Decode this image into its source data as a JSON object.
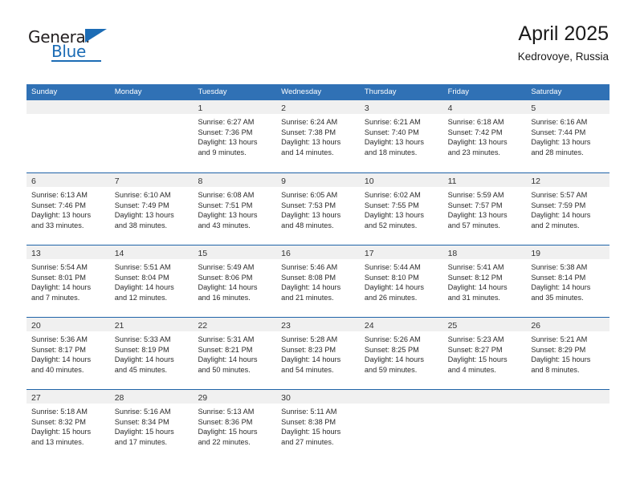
{
  "brand": {
    "name_part1": "General",
    "name_part2": "Blue",
    "triangle_icon": "triangle-icon",
    "accent_color": "#1c6cb5"
  },
  "header": {
    "title": "April 2025",
    "location": "Kedrovoye, Russia"
  },
  "theme": {
    "header_blue": "#3071b5",
    "row_rule": "#1f63a8",
    "daynum_band": "#f0f0f0"
  },
  "weekdays": [
    "Sunday",
    "Monday",
    "Tuesday",
    "Wednesday",
    "Thursday",
    "Friday",
    "Saturday"
  ],
  "weeks": [
    [
      {
        "day": "",
        "empty": true,
        "sunrise": "",
        "sunset": "",
        "daylight1": "",
        "daylight2": ""
      },
      {
        "day": "",
        "empty": true,
        "sunrise": "",
        "sunset": "",
        "daylight1": "",
        "daylight2": ""
      },
      {
        "day": "1",
        "sunrise": "Sunrise: 6:27 AM",
        "sunset": "Sunset: 7:36 PM",
        "daylight1": "Daylight: 13 hours",
        "daylight2": "and 9 minutes."
      },
      {
        "day": "2",
        "sunrise": "Sunrise: 6:24 AM",
        "sunset": "Sunset: 7:38 PM",
        "daylight1": "Daylight: 13 hours",
        "daylight2": "and 14 minutes."
      },
      {
        "day": "3",
        "sunrise": "Sunrise: 6:21 AM",
        "sunset": "Sunset: 7:40 PM",
        "daylight1": "Daylight: 13 hours",
        "daylight2": "and 18 minutes."
      },
      {
        "day": "4",
        "sunrise": "Sunrise: 6:18 AM",
        "sunset": "Sunset: 7:42 PM",
        "daylight1": "Daylight: 13 hours",
        "daylight2": "and 23 minutes."
      },
      {
        "day": "5",
        "sunrise": "Sunrise: 6:16 AM",
        "sunset": "Sunset: 7:44 PM",
        "daylight1": "Daylight: 13 hours",
        "daylight2": "and 28 minutes."
      }
    ],
    [
      {
        "day": "6",
        "sunrise": "Sunrise: 6:13 AM",
        "sunset": "Sunset: 7:46 PM",
        "daylight1": "Daylight: 13 hours",
        "daylight2": "and 33 minutes."
      },
      {
        "day": "7",
        "sunrise": "Sunrise: 6:10 AM",
        "sunset": "Sunset: 7:49 PM",
        "daylight1": "Daylight: 13 hours",
        "daylight2": "and 38 minutes."
      },
      {
        "day": "8",
        "sunrise": "Sunrise: 6:08 AM",
        "sunset": "Sunset: 7:51 PM",
        "daylight1": "Daylight: 13 hours",
        "daylight2": "and 43 minutes."
      },
      {
        "day": "9",
        "sunrise": "Sunrise: 6:05 AM",
        "sunset": "Sunset: 7:53 PM",
        "daylight1": "Daylight: 13 hours",
        "daylight2": "and 48 minutes."
      },
      {
        "day": "10",
        "sunrise": "Sunrise: 6:02 AM",
        "sunset": "Sunset: 7:55 PM",
        "daylight1": "Daylight: 13 hours",
        "daylight2": "and 52 minutes."
      },
      {
        "day": "11",
        "sunrise": "Sunrise: 5:59 AM",
        "sunset": "Sunset: 7:57 PM",
        "daylight1": "Daylight: 13 hours",
        "daylight2": "and 57 minutes."
      },
      {
        "day": "12",
        "sunrise": "Sunrise: 5:57 AM",
        "sunset": "Sunset: 7:59 PM",
        "daylight1": "Daylight: 14 hours",
        "daylight2": "and 2 minutes."
      }
    ],
    [
      {
        "day": "13",
        "sunrise": "Sunrise: 5:54 AM",
        "sunset": "Sunset: 8:01 PM",
        "daylight1": "Daylight: 14 hours",
        "daylight2": "and 7 minutes."
      },
      {
        "day": "14",
        "sunrise": "Sunrise: 5:51 AM",
        "sunset": "Sunset: 8:04 PM",
        "daylight1": "Daylight: 14 hours",
        "daylight2": "and 12 minutes."
      },
      {
        "day": "15",
        "sunrise": "Sunrise: 5:49 AM",
        "sunset": "Sunset: 8:06 PM",
        "daylight1": "Daylight: 14 hours",
        "daylight2": "and 16 minutes."
      },
      {
        "day": "16",
        "sunrise": "Sunrise: 5:46 AM",
        "sunset": "Sunset: 8:08 PM",
        "daylight1": "Daylight: 14 hours",
        "daylight2": "and 21 minutes."
      },
      {
        "day": "17",
        "sunrise": "Sunrise: 5:44 AM",
        "sunset": "Sunset: 8:10 PM",
        "daylight1": "Daylight: 14 hours",
        "daylight2": "and 26 minutes."
      },
      {
        "day": "18",
        "sunrise": "Sunrise: 5:41 AM",
        "sunset": "Sunset: 8:12 PM",
        "daylight1": "Daylight: 14 hours",
        "daylight2": "and 31 minutes."
      },
      {
        "day": "19",
        "sunrise": "Sunrise: 5:38 AM",
        "sunset": "Sunset: 8:14 PM",
        "daylight1": "Daylight: 14 hours",
        "daylight2": "and 35 minutes."
      }
    ],
    [
      {
        "day": "20",
        "sunrise": "Sunrise: 5:36 AM",
        "sunset": "Sunset: 8:17 PM",
        "daylight1": "Daylight: 14 hours",
        "daylight2": "and 40 minutes."
      },
      {
        "day": "21",
        "sunrise": "Sunrise: 5:33 AM",
        "sunset": "Sunset: 8:19 PM",
        "daylight1": "Daylight: 14 hours",
        "daylight2": "and 45 minutes."
      },
      {
        "day": "22",
        "sunrise": "Sunrise: 5:31 AM",
        "sunset": "Sunset: 8:21 PM",
        "daylight1": "Daylight: 14 hours",
        "daylight2": "and 50 minutes."
      },
      {
        "day": "23",
        "sunrise": "Sunrise: 5:28 AM",
        "sunset": "Sunset: 8:23 PM",
        "daylight1": "Daylight: 14 hours",
        "daylight2": "and 54 minutes."
      },
      {
        "day": "24",
        "sunrise": "Sunrise: 5:26 AM",
        "sunset": "Sunset: 8:25 PM",
        "daylight1": "Daylight: 14 hours",
        "daylight2": "and 59 minutes."
      },
      {
        "day": "25",
        "sunrise": "Sunrise: 5:23 AM",
        "sunset": "Sunset: 8:27 PM",
        "daylight1": "Daylight: 15 hours",
        "daylight2": "and 4 minutes."
      },
      {
        "day": "26",
        "sunrise": "Sunrise: 5:21 AM",
        "sunset": "Sunset: 8:29 PM",
        "daylight1": "Daylight: 15 hours",
        "daylight2": "and 8 minutes."
      }
    ],
    [
      {
        "day": "27",
        "sunrise": "Sunrise: 5:18 AM",
        "sunset": "Sunset: 8:32 PM",
        "daylight1": "Daylight: 15 hours",
        "daylight2": "and 13 minutes."
      },
      {
        "day": "28",
        "sunrise": "Sunrise: 5:16 AM",
        "sunset": "Sunset: 8:34 PM",
        "daylight1": "Daylight: 15 hours",
        "daylight2": "and 17 minutes."
      },
      {
        "day": "29",
        "sunrise": "Sunrise: 5:13 AM",
        "sunset": "Sunset: 8:36 PM",
        "daylight1": "Daylight: 15 hours",
        "daylight2": "and 22 minutes."
      },
      {
        "day": "30",
        "sunrise": "Sunrise: 5:11 AM",
        "sunset": "Sunset: 8:38 PM",
        "daylight1": "Daylight: 15 hours",
        "daylight2": "and 27 minutes."
      },
      {
        "day": "",
        "empty": true,
        "sunrise": "",
        "sunset": "",
        "daylight1": "",
        "daylight2": ""
      },
      {
        "day": "",
        "empty": true,
        "sunrise": "",
        "sunset": "",
        "daylight1": "",
        "daylight2": ""
      },
      {
        "day": "",
        "empty": true,
        "sunrise": "",
        "sunset": "",
        "daylight1": "",
        "daylight2": ""
      }
    ]
  ]
}
